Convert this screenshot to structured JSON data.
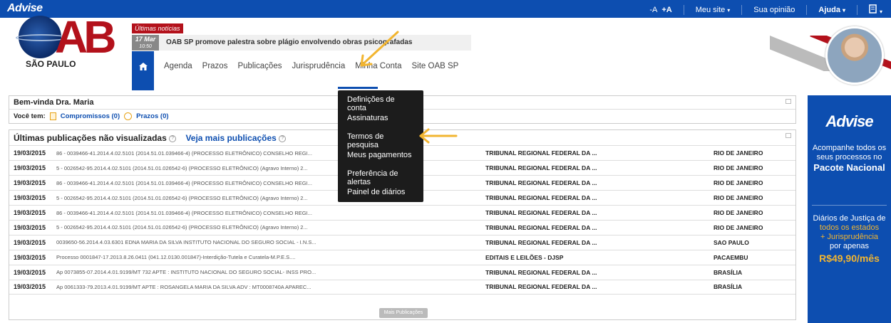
{
  "topbar": {
    "logo": "Advise",
    "font_small": "-A",
    "font_large": "+A",
    "meu_site": "Meu site",
    "sua_opiniao": "Sua opinião",
    "ajuda": "Ajuda",
    "caret": "▾"
  },
  "branding": {
    "letters": "AB",
    "city": "SÃO PAULO"
  },
  "news": {
    "label": "Últimas notícias",
    "day": "17 Mar",
    "time": "10:50",
    "headline": "OAB SP promove palestra sobre plágio envolvendo obras psicografadas"
  },
  "nav": {
    "items": [
      "Agenda",
      "Prazos",
      "Publicações",
      "Jurisprudência",
      "Minha Conta",
      "Site OAB SP"
    ]
  },
  "welcome": {
    "title": "Bem-vinda Dra. Maria",
    "voce_tem": "Você tem:",
    "compromissos": "Compromissos (0)",
    "prazos": "Prazos (0)"
  },
  "publications": {
    "title": "Últimas publicações não visualizadas",
    "help": "?",
    "more_link": "Veja mais publicações",
    "more_button": "Mais Publicações",
    "rows": [
      {
        "date": "19/03/2015",
        "desc": "86 - 0039466-41.2014.4.02.5101 (2014.51.01.039466-4) (PROCESSO ELETRÔNICO) CONSELHO REGI...",
        "court": "TRIBUNAL REGIONAL FEDERAL DA ...",
        "city": "RIO DE JANEIRO"
      },
      {
        "date": "19/03/2015",
        "desc": "5 - 0026542-95.2014.4.02.5101 (2014.51.01.026542-6) (PROCESSO ELETRÔNICO) (Agravo Interno) 2...",
        "court": "TRIBUNAL REGIONAL FEDERAL DA ...",
        "city": "RIO DE JANEIRO"
      },
      {
        "date": "19/03/2015",
        "desc": "86 - 0039466-41.2014.4.02.5101 (2014.51.01.039466-4) (PROCESSO ELETRÔNICO) CONSELHO REGI...",
        "court": "TRIBUNAL REGIONAL FEDERAL DA ...",
        "city": "RIO DE JANEIRO"
      },
      {
        "date": "19/03/2015",
        "desc": "5 - 0026542-95.2014.4.02.5101 (2014.51.01.026542-6) (PROCESSO ELETRÔNICO) (Agravo Interno) 2...",
        "court": "TRIBUNAL REGIONAL FEDERAL DA ...",
        "city": "RIO DE JANEIRO"
      },
      {
        "date": "19/03/2015",
        "desc": "86 - 0039466-41.2014.4.02.5101 (2014.51.01.039466-4) (PROCESSO ELETRÔNICO) CONSELHO REGI...",
        "court": "TRIBUNAL REGIONAL FEDERAL DA ...",
        "city": "RIO DE JANEIRO"
      },
      {
        "date": "19/03/2015",
        "desc": "5 - 0026542-95.2014.4.02.5101 (2014.51.01.026542-6) (PROCESSO ELETRÔNICO) (Agravo Interno) 2...",
        "court": "TRIBUNAL REGIONAL FEDERAL DA ...",
        "city": "RIO DE JANEIRO"
      },
      {
        "date": "19/03/2015",
        "desc": "0039650-56.2014.4.03.6301 EDNA MARIA DA SILVA INSTITUTO NACIONAL DO SEGURO SOCIAL - I.N.S...",
        "court": "TRIBUNAL REGIONAL FEDERAL DA ...",
        "city": "SAO PAULO"
      },
      {
        "date": "19/03/2015",
        "desc": "Processo 0001847-17.2013.8.26.0411 (041.12.0130.001847)-Interdição-Tutela e Curatela-M.P.E.S....",
        "court": "EDITAIS E LEILÕES - DJSP",
        "city": "PACAEMBU"
      },
      {
        "date": "19/03/2015",
        "desc": "Ap 0073855-07.2014.4.01.9199/MT 732 APTE : INSTITUTO NACIONAL DO SEGURO SOCIAL- INSS PRO...",
        "court": "TRIBUNAL REGIONAL FEDERAL DA ...",
        "city": "BRASÍLIA"
      },
      {
        "date": "19/03/2015",
        "desc": "Ap 0061333-79.2013.4.01.9199/MT APTE : ROSANGELA MARIA DA SILVA ADV : MT0008740A APAREC...",
        "court": "TRIBUNAL REGIONAL FEDERAL DA ...",
        "city": "BRASÍLIA"
      }
    ]
  },
  "dropdown": {
    "items": [
      "Definições de conta",
      "Assinaturas",
      "Termos de pesquisa",
      "Meus pagamentos",
      "Preferência de alertas",
      "Painel de diários"
    ]
  },
  "ad": {
    "brand": "Advise",
    "line1": "Acompanhe todos os seus processos no",
    "line2": "Pacote Nacional",
    "line3a": "Diários de Justiça de",
    "line3b": "todos os estados",
    "line3c": "+ Jurisprudência",
    "line3d": "por apenas",
    "price": "R$49,90/mês"
  },
  "colors": {
    "primary": "#0d4eb0",
    "oab_red": "#b3111b",
    "highlight": "#f2b530",
    "menu_dark": "#1c1c1c"
  }
}
